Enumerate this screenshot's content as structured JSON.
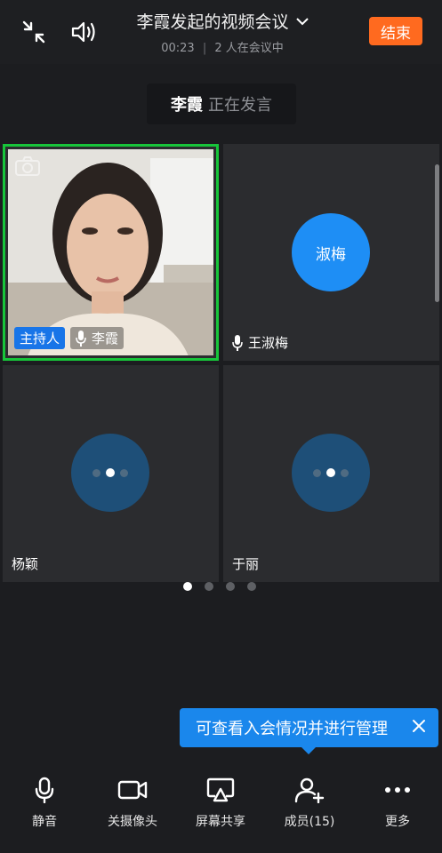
{
  "header": {
    "title": "李霞发起的视频会议",
    "timer": "00:23",
    "participants_status": "2 人在会议中",
    "end_label": "结束"
  },
  "speaking": {
    "name": "李霞",
    "status": "正在发言"
  },
  "tiles": [
    {
      "name": "李霞",
      "host_badge": "主持人",
      "video": true,
      "active": true
    },
    {
      "name": "王淑梅",
      "avatar_text": "淑梅",
      "mic": true
    },
    {
      "name": "杨颖"
    },
    {
      "name": "于丽"
    }
  ],
  "pager": {
    "count": 4,
    "current": 1
  },
  "tooltip": {
    "text": "可查看入会情况并进行管理"
  },
  "toolbar": {
    "mute_label": "静音",
    "camera_label": "关摄像头",
    "share_label": "屏幕共享",
    "members_label": "成员(15)",
    "more_label": "更多"
  },
  "colors": {
    "accent_blue": "#1a87ec",
    "end_orange": "#ff6a1f",
    "active_border": "#17c53a",
    "avatar_blue": "#1e8ef5",
    "avatar_dark": "#1e4f78"
  }
}
